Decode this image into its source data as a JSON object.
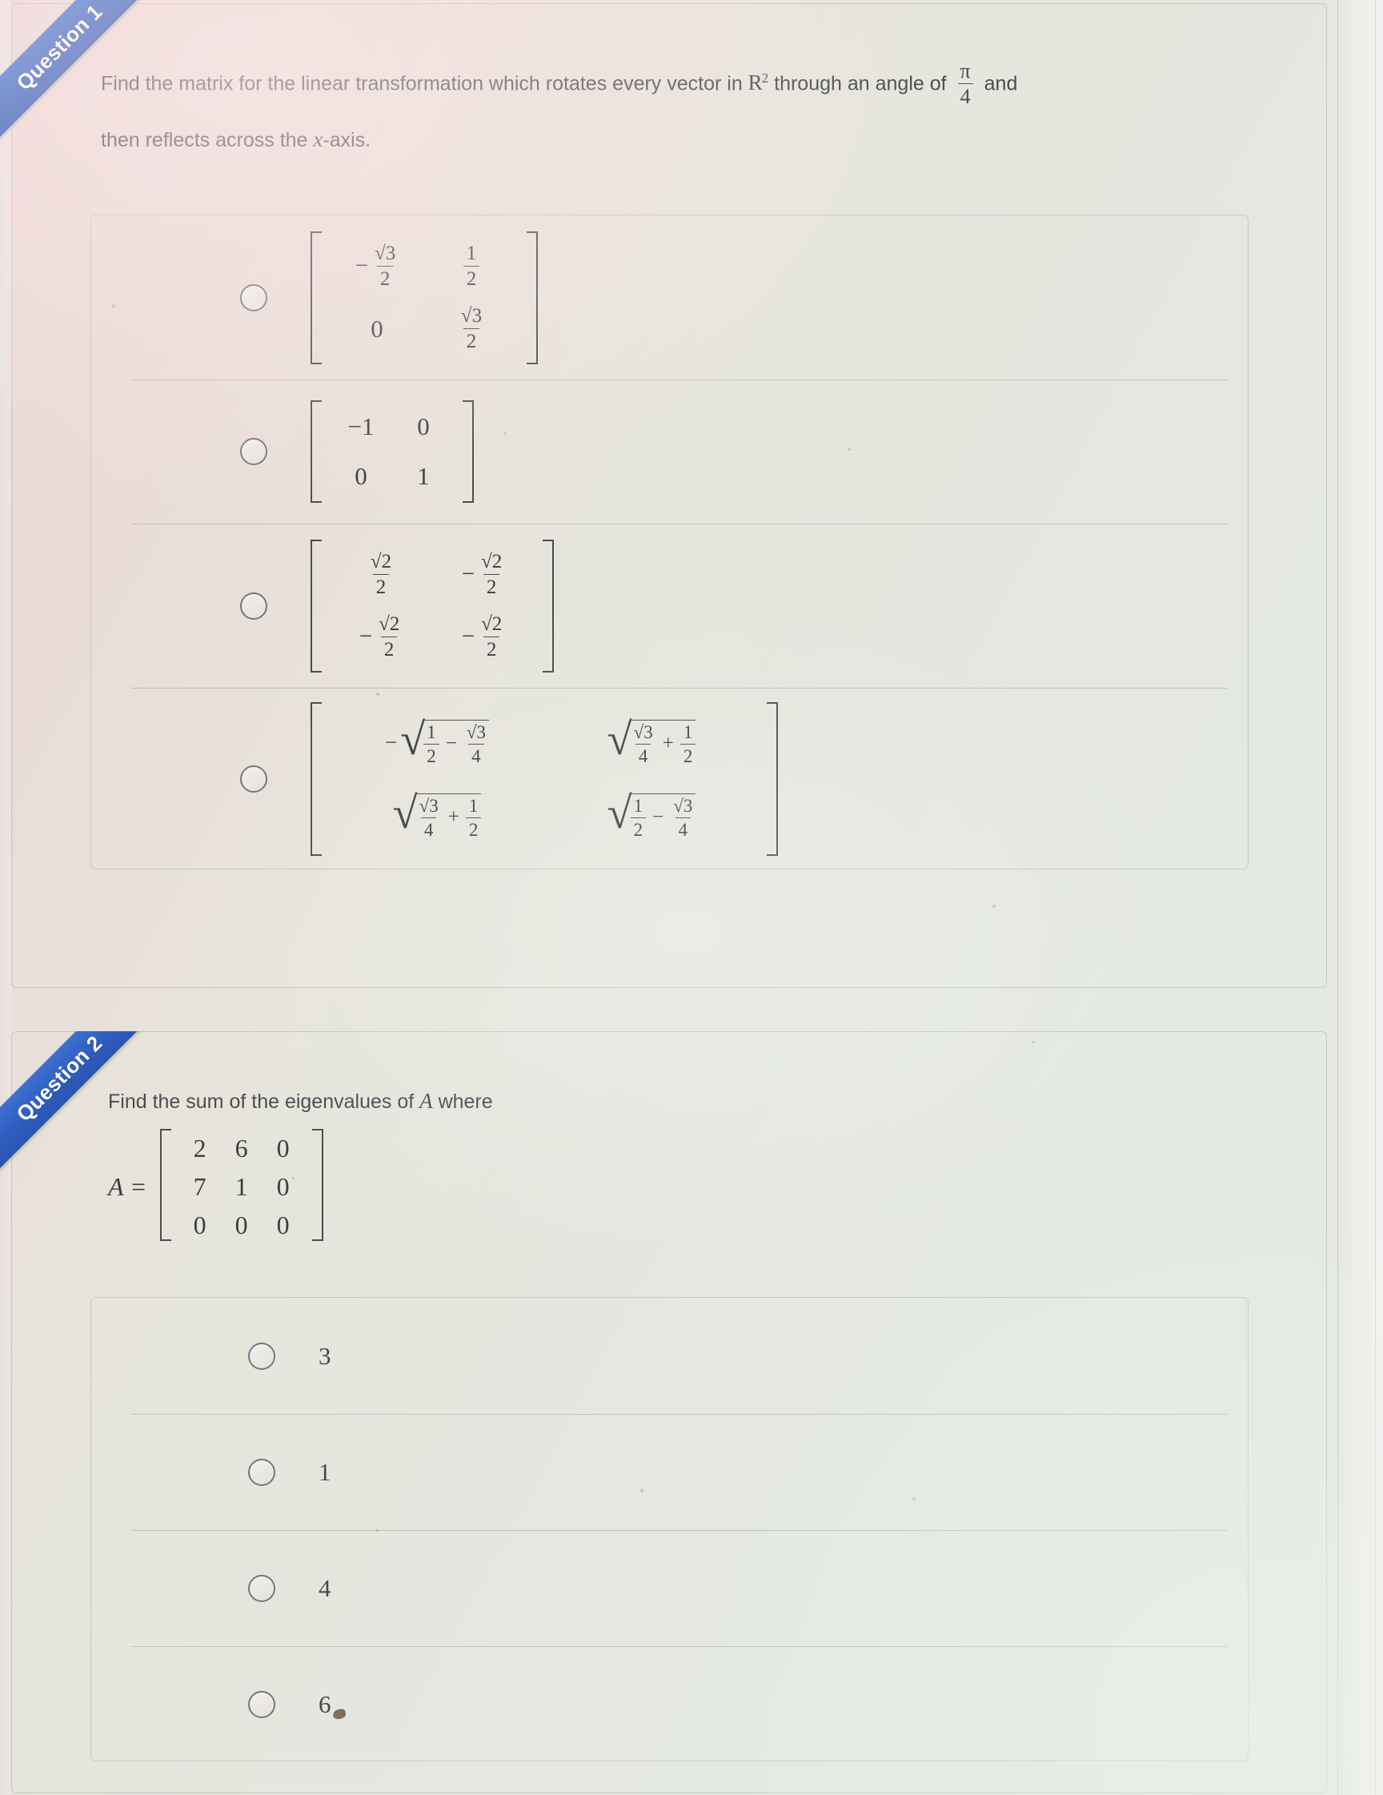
{
  "quiz": {
    "questions": [
      {
        "ribbon_label": "Question 1",
        "prompt_line1_a": "Find the matrix for the linear transformation which rotates every vector in ",
        "prompt_line1_bb": "R",
        "prompt_line1_bb_sup": "2",
        "prompt_line1_b": " through an angle of ",
        "angle_numerator": "π",
        "angle_denominator": "4",
        "prompt_line1_c": " and",
        "prompt_line2_a": "then reflects across the ",
        "prompt_line2_var": "x",
        "prompt_line2_b": "-axis.",
        "options": [
          {
            "id": "q1-opt-a",
            "kind": "matrix",
            "rows": [
              [
                {
                  "type": "frac",
                  "neg": true,
                  "num": "√3",
                  "den": "2"
                },
                {
                  "type": "frac",
                  "neg": false,
                  "num": "1",
                  "den": "2"
                }
              ],
              [
                {
                  "type": "plain",
                  "value": "0"
                },
                {
                  "type": "frac",
                  "neg": false,
                  "num": "√3",
                  "den": "2"
                }
              ]
            ]
          },
          {
            "id": "q1-opt-b",
            "kind": "matrix",
            "rows": [
              [
                {
                  "type": "plain",
                  "value": "−1"
                },
                {
                  "type": "plain",
                  "value": "0"
                }
              ],
              [
                {
                  "type": "plain",
                  "value": "0"
                },
                {
                  "type": "plain",
                  "value": "1"
                }
              ]
            ]
          },
          {
            "id": "q1-opt-c",
            "kind": "matrix",
            "rows": [
              [
                {
                  "type": "frac",
                  "neg": false,
                  "num": "√2",
                  "den": "2"
                },
                {
                  "type": "frac",
                  "neg": true,
                  "num": "√2",
                  "den": "2"
                }
              ],
              [
                {
                  "type": "frac",
                  "neg": true,
                  "num": "√2",
                  "den": "2"
                },
                {
                  "type": "frac",
                  "neg": true,
                  "num": "√2",
                  "den": "2"
                }
              ]
            ]
          },
          {
            "id": "q1-opt-d",
            "kind": "matrix",
            "rows": [
              [
                {
                  "type": "radfrac",
                  "neg": true,
                  "a_num": "1",
                  "a_den": "2",
                  "op": "−",
                  "b_num": "√3",
                  "b_den": "4"
                },
                {
                  "type": "radfrac",
                  "neg": false,
                  "a_num": "√3",
                  "a_den": "4",
                  "op": "+",
                  "b_num": "1",
                  "b_den": "2"
                }
              ],
              [
                {
                  "type": "radfrac",
                  "neg": false,
                  "a_num": "√3",
                  "a_den": "4",
                  "op": "+",
                  "b_num": "1",
                  "b_den": "2"
                },
                {
                  "type": "radfrac",
                  "neg": false,
                  "a_num": "1",
                  "a_den": "2",
                  "op": "−",
                  "b_num": "√3",
                  "b_den": "4"
                }
              ]
            ]
          }
        ]
      },
      {
        "ribbon_label": "Question 2",
        "prompt_a": "Find the sum of the eigenvalues of ",
        "prompt_var": "A",
        "prompt_b": " where",
        "matrix_label": "A =",
        "matrix_rows": [
          [
            "2",
            "6",
            "0"
          ],
          [
            "7",
            "1",
            "0"
          ],
          [
            "0",
            "0",
            "0"
          ]
        ],
        "options": [
          {
            "id": "q2-opt-a",
            "kind": "plain",
            "value": "3"
          },
          {
            "id": "q2-opt-b",
            "kind": "plain",
            "value": "1"
          },
          {
            "id": "q2-opt-c",
            "kind": "plain",
            "value": "4"
          },
          {
            "id": "q2-opt-d",
            "kind": "plain",
            "value": "6"
          }
        ]
      }
    ]
  },
  "colors": {
    "ribbon_blue": "#2f5ec0",
    "ribbon_blue_dark": "#1e3f8c",
    "text": "#4a4d52",
    "math_text": "#3b3e42",
    "card_border": "#a09e98",
    "divider": "#96948e",
    "radio_border": "#75777a",
    "page_warm": "#ecd6d6",
    "page_cool": "#e5e9e3"
  }
}
